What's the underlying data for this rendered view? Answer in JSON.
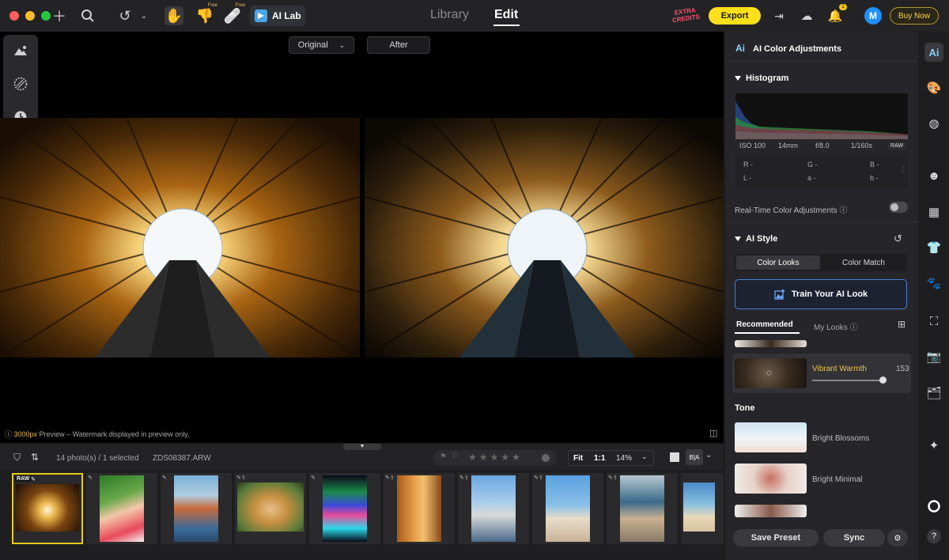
{
  "topbar": {
    "traffic_colors": [
      "#ff5f57",
      "#febc2e",
      "#28c840"
    ],
    "free_label": "Free",
    "ailab_label": "AI Lab",
    "tabs": {
      "library": "Library",
      "edit": "Edit"
    },
    "extra_credits": "EXTRA CREDITS",
    "export_label": "Export",
    "notification_count": "1",
    "avatar_initial": "M",
    "buy_now": "Buy Now"
  },
  "canvas": {
    "compare_left": "Original",
    "compare_right": "After",
    "preview_size": "3000px",
    "preview_note": " Preview – Watermark displayed in preview only."
  },
  "filmstrip": {
    "count_label": "14 photo(s) / 1 selected",
    "filename": "ZDS08387.ARW",
    "zoom_fit": "Fit",
    "zoom_1to1": "1:1",
    "zoom_percent": "14%",
    "raw_tag": "RAW",
    "ba_label": "B|A"
  },
  "panel": {
    "title": "AI Color Adjustments",
    "ai_logo": "Ai",
    "histogram_title": "Histogram",
    "exif": {
      "iso": "ISO 100",
      "focal": "14mm",
      "aperture": "f/8.0",
      "shutter": "1/160s",
      "raw": "RAW"
    },
    "rgb": {
      "r": "R -",
      "g": "G -",
      "b": "B -",
      "l": "L -",
      "a": "a -",
      "bb": "b -"
    },
    "realtime_label": "Real-Time Color Adjustments",
    "ai_style_title": "AI Style",
    "seg_color_looks": "Color Looks",
    "seg_color_match": "Color Match",
    "train_label": "Train Your AI Look",
    "tab_recommended": "Recommended",
    "tab_my_looks": "My Looks",
    "looks": [
      {
        "name": "Vibrant Warmth",
        "value": "153",
        "highlight": "#e8c44a"
      },
      {
        "name": "Bright Blossoms"
      },
      {
        "name": "Bright Minimal"
      }
    ],
    "tone_title": "Tone",
    "save_preset": "Save Preset",
    "sync": "Sync"
  },
  "rail": {
    "icons": [
      "ai-icon",
      "palette-icon",
      "texture-icon",
      "portrait-icon",
      "grid-icon",
      "shirt-icon",
      "paw-icon",
      "crop-icon",
      "camera-icon",
      "folder-eye-icon",
      "star-icon",
      "circle-icon",
      "help-icon"
    ],
    "help": "?"
  }
}
